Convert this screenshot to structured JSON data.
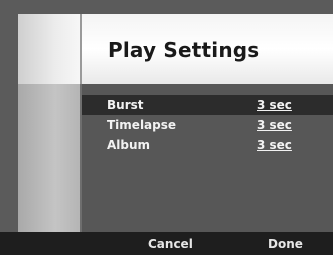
{
  "screen": {
    "title": "Play Settings"
  },
  "settings": {
    "rows": [
      {
        "label": "Burst",
        "value": "3 sec",
        "selected": true
      },
      {
        "label": "Timelapse",
        "value": "3 sec",
        "selected": false
      },
      {
        "label": "Album",
        "value": "3 sec",
        "selected": false
      }
    ]
  },
  "softkeys": {
    "cancel_label": "Cancel",
    "done_label": "Done"
  },
  "colors": {
    "background": "#5b5b5b",
    "header": "#ffffff",
    "selected_row": "#2c2c2c",
    "softkey_bar": "#1e1e1e",
    "text": "#f2f2f2"
  }
}
